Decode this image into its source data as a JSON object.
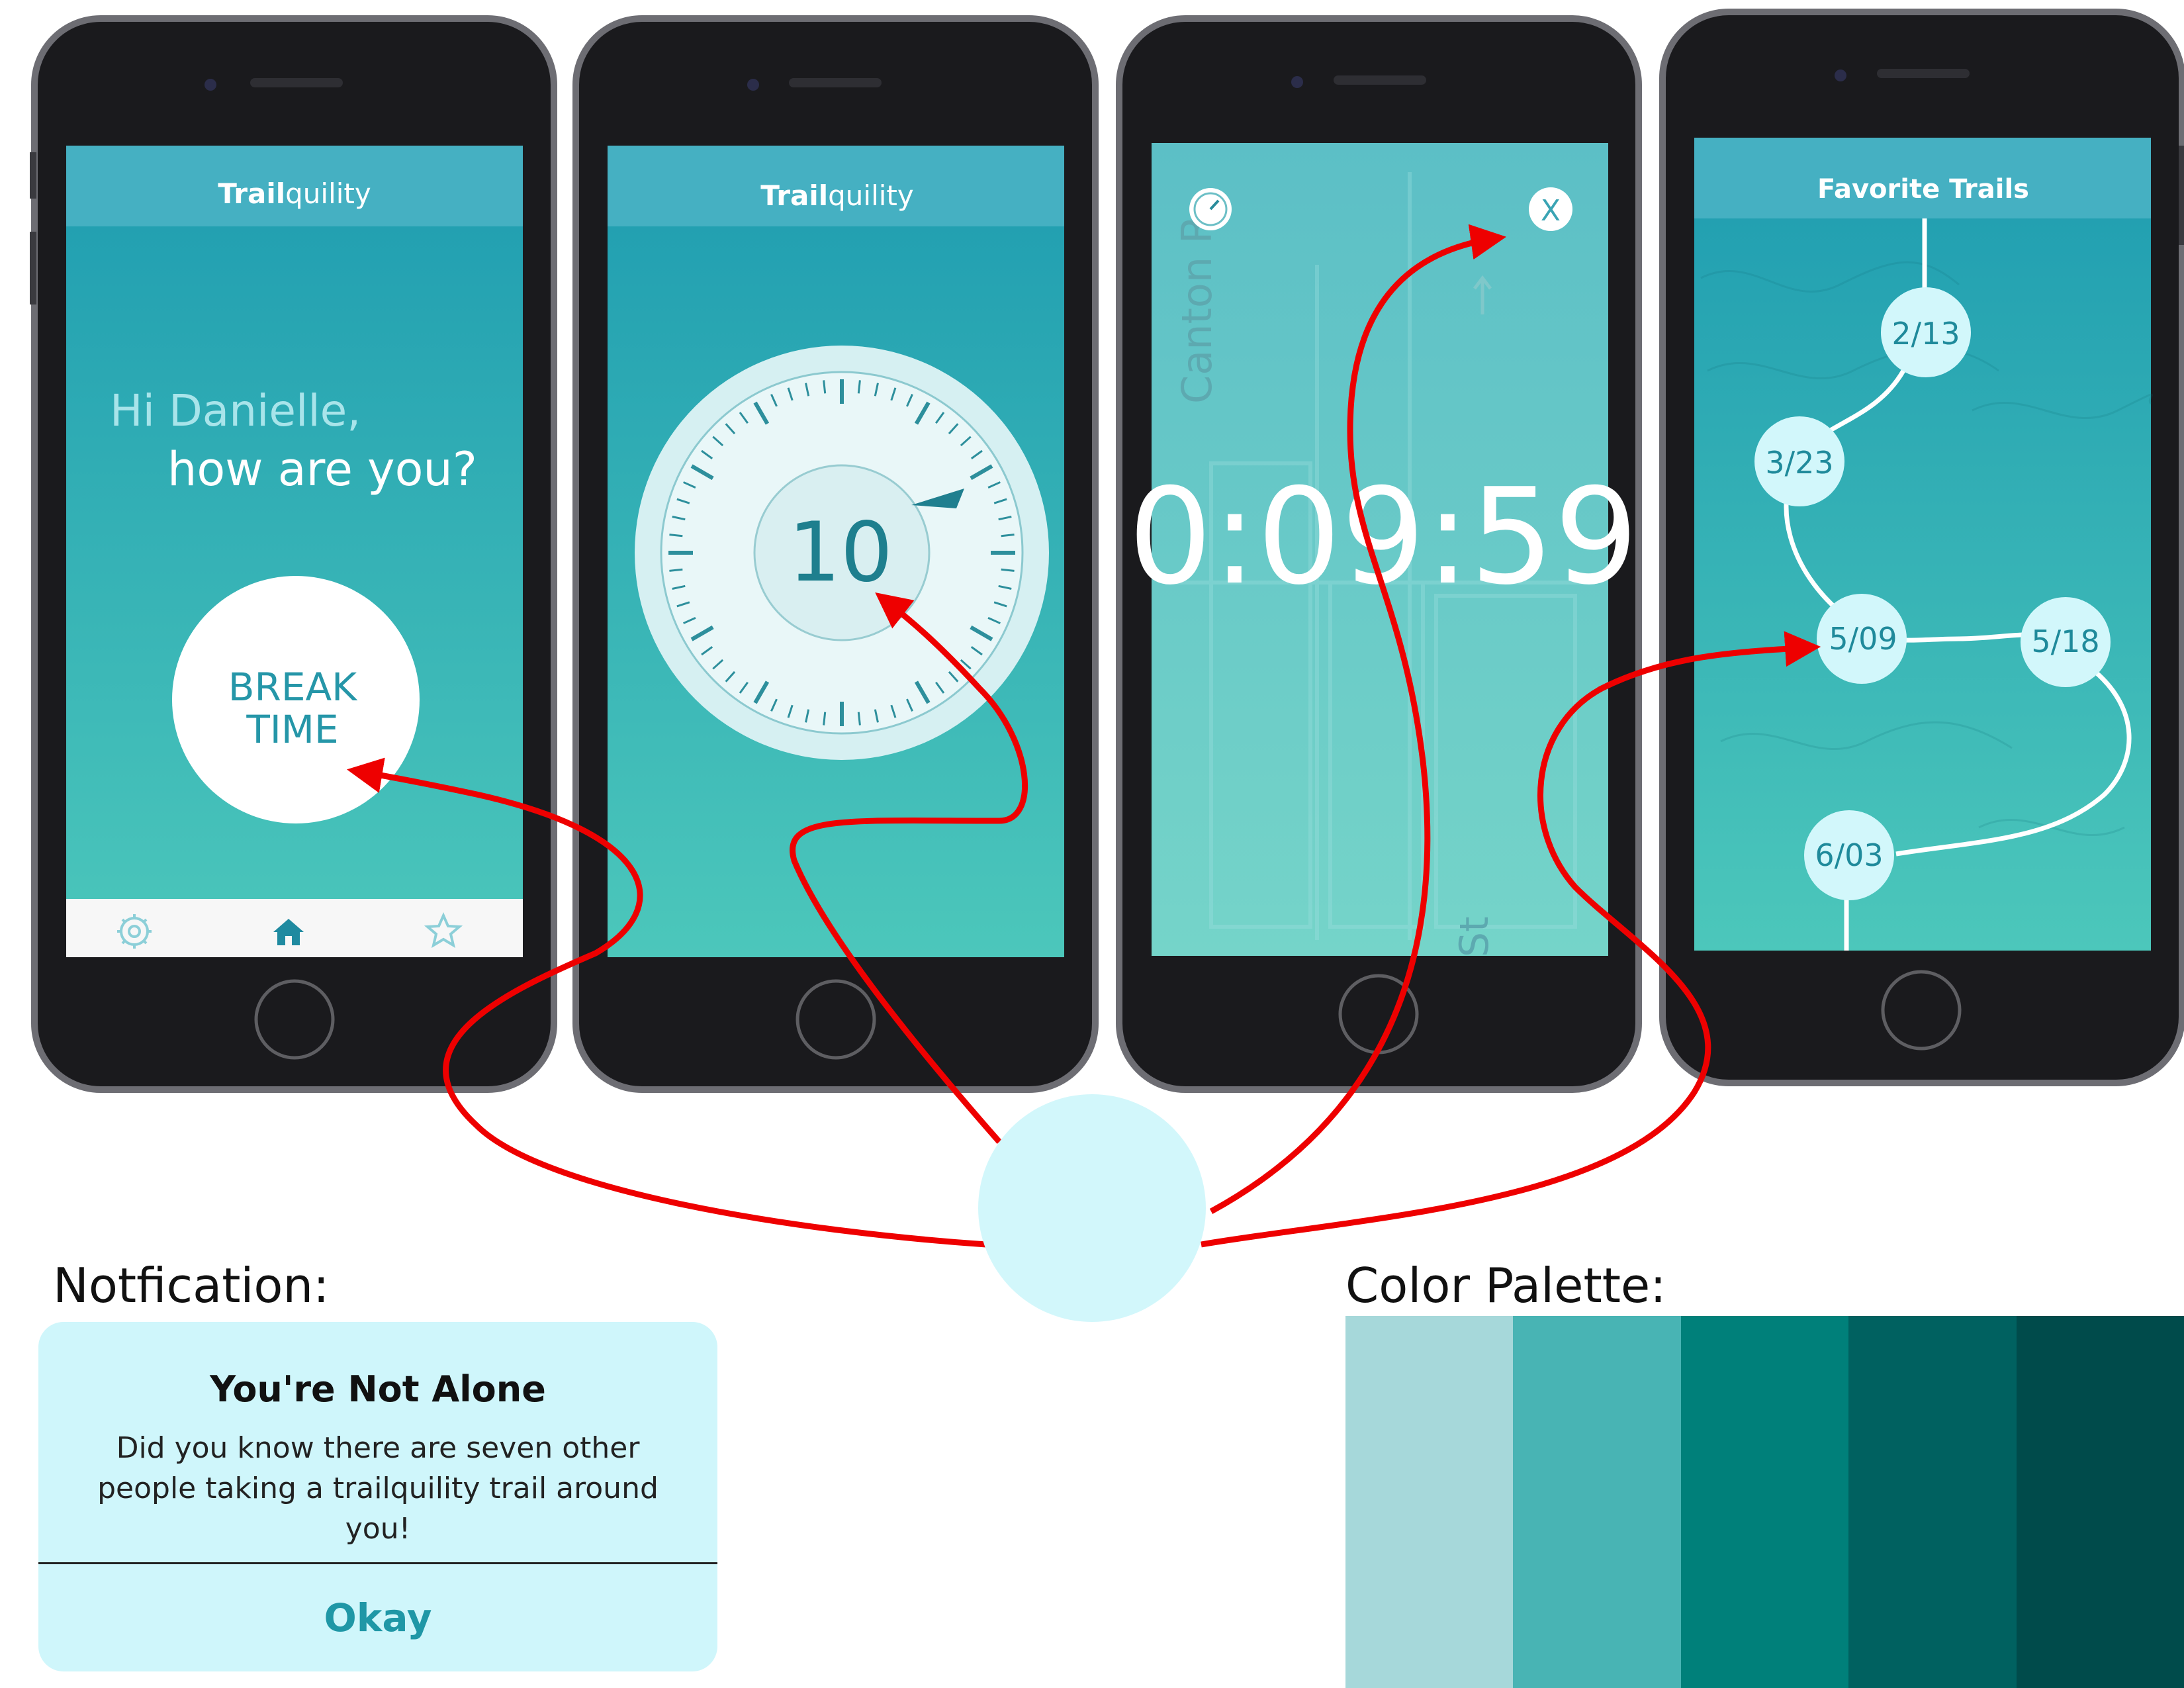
{
  "screens": {
    "home": {
      "app_title_bold": "Trail",
      "app_title_rest": "quility",
      "greeting_line1": "Hi Danielle,",
      "greeting_line2": "how are you?",
      "button_line1": "BREAK",
      "button_line2": "TIME",
      "tabbar_icons": [
        "gear-icon",
        "home-icon",
        "star-icon"
      ]
    },
    "timer_picker": {
      "app_title_bold": "Trail",
      "app_title_rest": "quility",
      "minutes": "10"
    },
    "countdown": {
      "time": "0:09:59",
      "map_street_label": "Canton R",
      "close_label": "X",
      "map_street_label2": "St"
    },
    "favorites": {
      "title": "Favorite Trails",
      "dates": [
        "2/13",
        "3/23",
        "5/09",
        "5/18",
        "6/03"
      ]
    }
  },
  "notification_section": {
    "label": "Notfication:",
    "title": "You're Not Alone",
    "body": "Did you know there are seven other people taking a trailquility trail around you!",
    "button": "Okay"
  },
  "palette_section": {
    "label": "Color Palette:",
    "colors": [
      "#a6d8da",
      "#48b4b4",
      "#00807a",
      "#006160",
      "#004b4b"
    ]
  },
  "accent_colors": {
    "screen_top": "#1f9fb2",
    "screen_bottom": "#4cc7bb",
    "annotation_arrow": "#ee0000",
    "hub_circle": "#d2f7fb"
  }
}
